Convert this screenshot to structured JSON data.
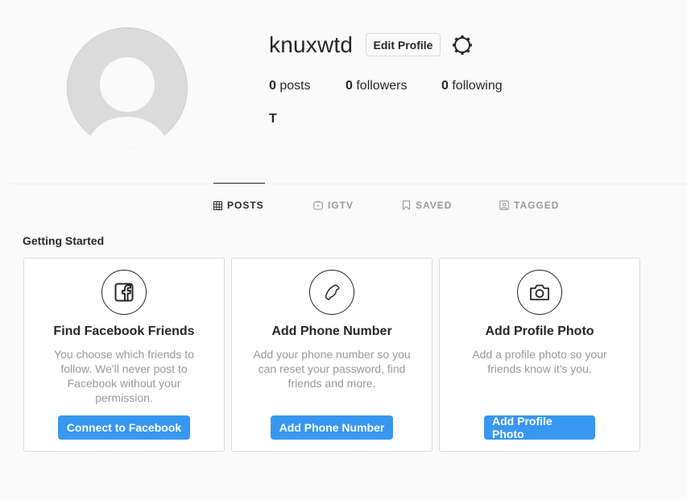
{
  "profile": {
    "username": "knuxwtd",
    "edit_label": "Edit Profile",
    "full_name": "T",
    "stats": [
      {
        "count": "0",
        "label": " posts"
      },
      {
        "count": "0",
        "label": " followers"
      },
      {
        "count": "0",
        "label": " following"
      }
    ]
  },
  "tabs": [
    {
      "label": "POSTS",
      "icon": "grid-icon",
      "active": true
    },
    {
      "label": "IGTV",
      "icon": "igtv-icon",
      "active": false
    },
    {
      "label": "SAVED",
      "icon": "bookmark-icon",
      "active": false
    },
    {
      "label": "TAGGED",
      "icon": "tagged-icon",
      "active": false
    }
  ],
  "getting_started": {
    "title": "Getting Started",
    "cards": [
      {
        "icon": "facebook-icon",
        "title": "Find Facebook Friends",
        "desc": "You choose which friends to follow. We'll never post to Facebook without your permission.",
        "button": "Connect to Facebook"
      },
      {
        "icon": "phone-icon",
        "title": "Add Phone Number",
        "desc": "Add your phone number so you can reset your password, find friends and more.",
        "button": "Add Phone Number"
      },
      {
        "icon": "camera-icon",
        "title": "Add Profile Photo",
        "desc": "Add a profile photo so your friends know it's you.",
        "button": "Add Profile Photo"
      }
    ]
  },
  "colors": {
    "accent": "#3897f0",
    "background": "#fafafa",
    "text": "#262626",
    "muted": "#999999"
  }
}
